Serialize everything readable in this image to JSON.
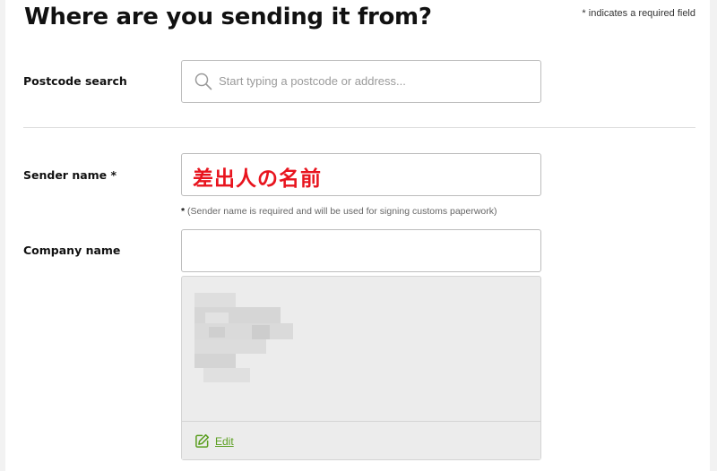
{
  "header": {
    "title": "Where are you sending it from?",
    "required_note": "* indicates a required field"
  },
  "postcode": {
    "label": "Postcode search",
    "placeholder": "Start typing a postcode or address..."
  },
  "sender": {
    "label": "Sender name *",
    "value": "差出人の名前",
    "hint_star": "*",
    "hint_text": " (Sender name is required and will be used for signing customs paperwork)"
  },
  "company": {
    "label": "Company name",
    "value": ""
  },
  "address": {
    "edit_label": "Edit"
  },
  "colors": {
    "accent_green": "#5a9e1f",
    "sender_text_red": "#e8141e"
  }
}
